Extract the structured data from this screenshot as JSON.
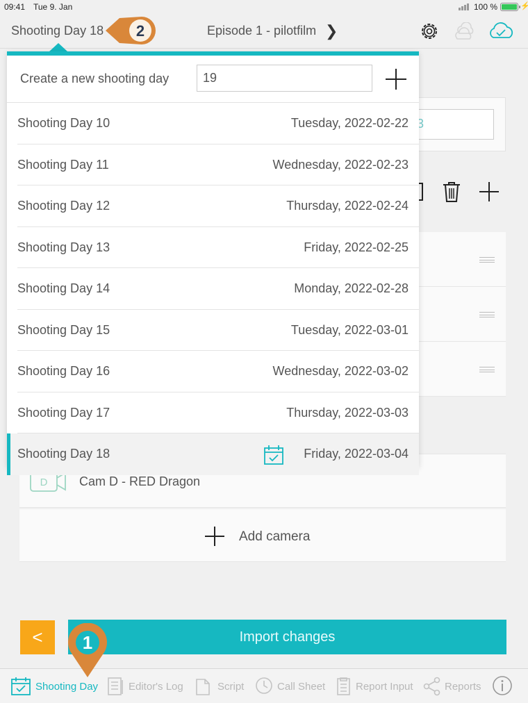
{
  "status_bar": {
    "time": "09:41",
    "date": "Tue 9. Jan",
    "battery": "100 %"
  },
  "nav": {
    "current_day": "Shooting Day 18",
    "episode": "Episode 1 - pilotfilm",
    "badge_2": "2"
  },
  "popover": {
    "create_label": "Create a new shooting day",
    "create_value": "19",
    "days": [
      {
        "name": "Shooting Day 10",
        "date": "Tuesday, 2022-02-22"
      },
      {
        "name": "Shooting Day 11",
        "date": "Wednesday, 2022-02-23"
      },
      {
        "name": "Shooting Day 12",
        "date": "Thursday, 2022-02-24"
      },
      {
        "name": "Shooting Day 13",
        "date": "Friday, 2022-02-25"
      },
      {
        "name": "Shooting Day 14",
        "date": "Monday, 2022-02-28"
      },
      {
        "name": "Shooting Day 15",
        "date": "Tuesday, 2022-03-01"
      },
      {
        "name": "Shooting Day 16",
        "date": "Wednesday, 2022-03-02"
      },
      {
        "name": "Shooting Day 17",
        "date": "Thursday, 2022-03-03"
      },
      {
        "name": "Shooting Day 18",
        "date": "Friday, 2022-03-04",
        "selected": true
      }
    ]
  },
  "background": {
    "field_fragment": "3"
  },
  "camera": {
    "label": "Cam D - RED Dragon",
    "icon_letter": "D"
  },
  "add_camera": {
    "label": "Add camera"
  },
  "actions": {
    "back": "<",
    "import": "Import changes",
    "badge_1": "1"
  },
  "tabs": [
    {
      "label": "Shooting Day",
      "icon": "calendar-icon",
      "active": true
    },
    {
      "label": "Editor's Log",
      "icon": "log-icon"
    },
    {
      "label": "Script",
      "icon": "script-icon"
    },
    {
      "label": "Call Sheet",
      "icon": "clock-icon"
    },
    {
      "label": "Report Input",
      "icon": "clipboard-icon"
    },
    {
      "label": "Reports",
      "icon": "share-icon"
    }
  ],
  "colors": {
    "accent": "#16b8c1",
    "orange": "#f8a719",
    "badge": "#d9873a",
    "badge_text": "#2b3a55"
  }
}
